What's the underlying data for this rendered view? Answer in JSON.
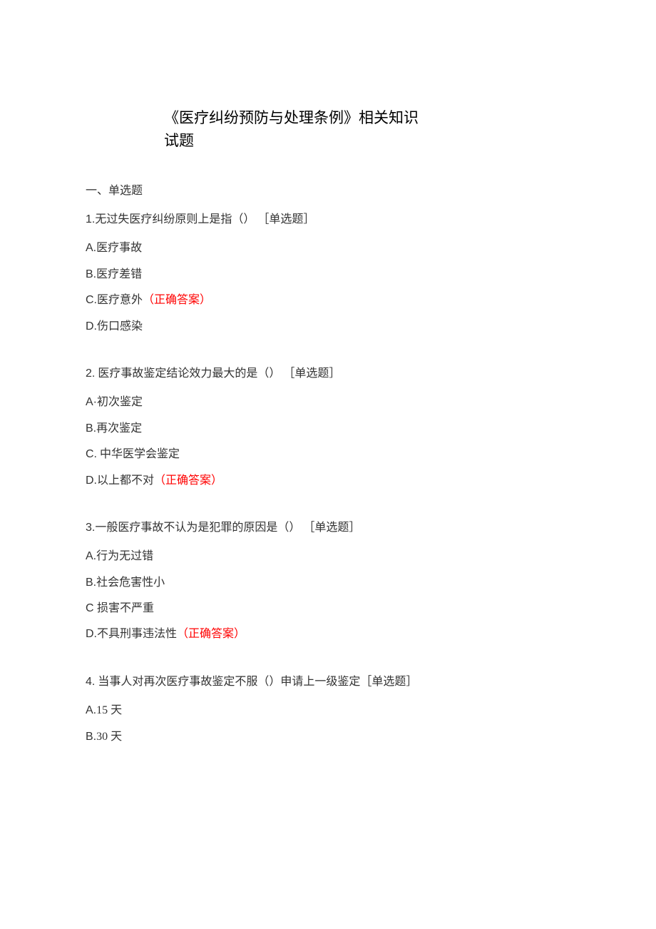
{
  "title": {
    "line1": "《医疗纠纷预防与处理条例》相关知识",
    "line2": "试题"
  },
  "section_heading": "一、单选题",
  "answer_label": "（正确答案）",
  "questions": [
    {
      "number": "1.",
      "text": "无过失医疗纠纷原则上是指（） ［单选题］",
      "options": [
        {
          "letter": "A.",
          "text": "医疗事故",
          "correct": false
        },
        {
          "letter": "B.",
          "text": "医疗差错",
          "correct": false
        },
        {
          "letter": "C.",
          "text": "医疗意外",
          "correct": true
        },
        {
          "letter": "D.",
          "text": "伤口感染",
          "correct": false
        }
      ]
    },
    {
      "number": "2.",
      "text": " 医疗事故鉴定结论效力最大的是（） ［单选题］",
      "options": [
        {
          "letter": "A·",
          "text": "初次鉴定",
          "correct": false
        },
        {
          "letter": "B.",
          "text": "再次鉴定",
          "correct": false
        },
        {
          "letter": "C.",
          "text": " 中华医学会鉴定",
          "correct": false
        },
        {
          "letter": "D.",
          "text": "以上都不对",
          "correct": true
        }
      ]
    },
    {
      "number": "3.",
      "text": "一般医疗事故不认为是犯罪的原因是（） ［单选题］",
      "options": [
        {
          "letter": "A.",
          "text": "行为无过错",
          "correct": false
        },
        {
          "letter": "B.",
          "text": "社会危害性小",
          "correct": false
        },
        {
          "letter": "C ",
          "text": "损害不严重",
          "correct": false
        },
        {
          "letter": "D.",
          "text": "不具刑事违法性",
          "correct": true
        }
      ]
    },
    {
      "number": "4.",
      "text": " 当事人对再次医疗事故鉴定不服（）申请上一级鉴定［单选题］",
      "options": [
        {
          "letter": "A.",
          "text": "15 天",
          "correct": false
        },
        {
          "letter": "B.",
          "text": "30 天",
          "correct": false
        }
      ]
    }
  ]
}
